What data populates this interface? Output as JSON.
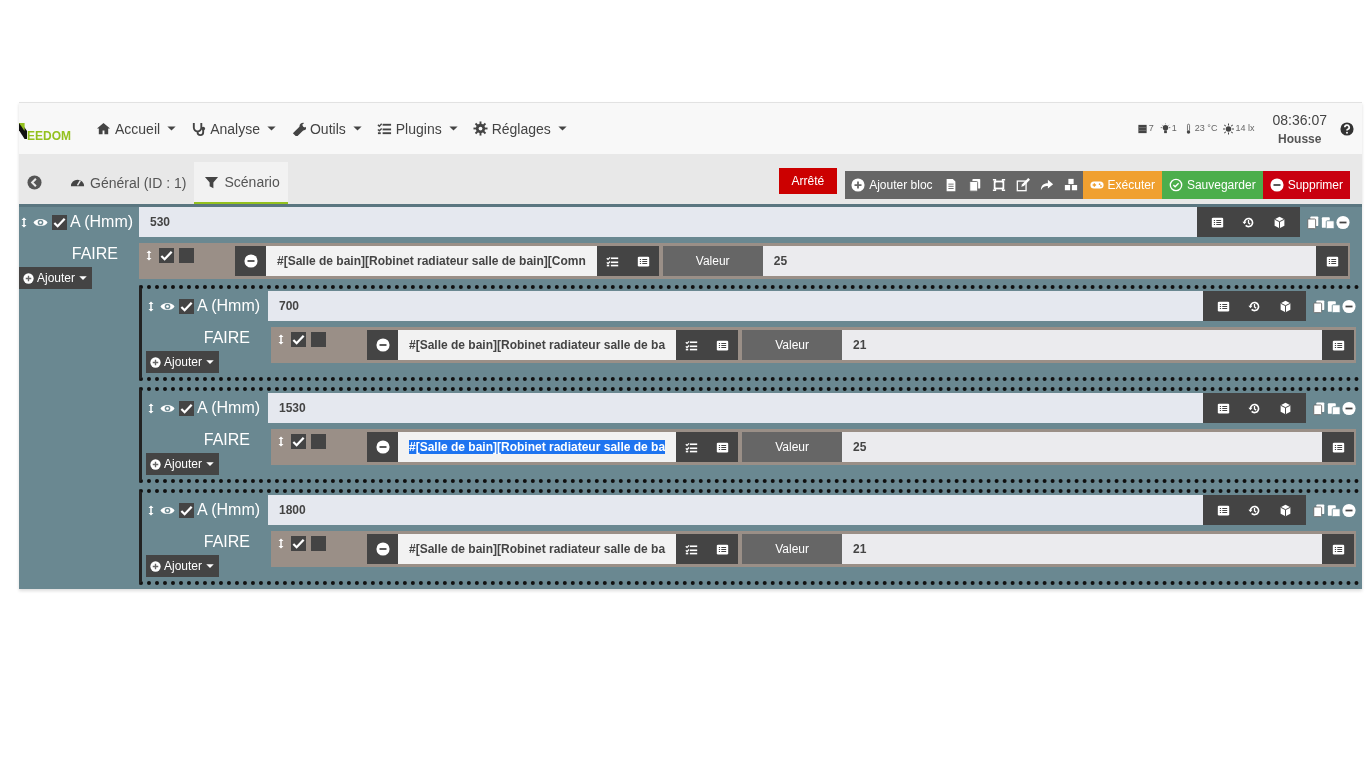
{
  "logo": {
    "text": "EEDOM"
  },
  "nav": [
    {
      "label": "Accueil"
    },
    {
      "label": "Analyse"
    },
    {
      "label": "Outils"
    },
    {
      "label": "Plugins"
    },
    {
      "label": "Réglages"
    }
  ],
  "status": {
    "widgets": [
      {
        "value": "7"
      },
      {
        "value": "1"
      },
      {
        "value": "23 °C"
      },
      {
        "value": "14 lx"
      }
    ],
    "time": "08:36:07",
    "user": "Housse"
  },
  "tabs": [
    {
      "label": "Général (ID : 1)",
      "selected": false
    },
    {
      "label": "Scénario",
      "selected": true
    }
  ],
  "state_badge": "Arrêté",
  "toolbar": {
    "add_block": "Ajouter bloc",
    "actions": [
      {
        "label": "Exécuter",
        "color": "#f0a030"
      },
      {
        "label": "Sauvegarder",
        "color": "#4cae4c"
      },
      {
        "label": "Supprimer",
        "color": "#c9000f"
      }
    ]
  },
  "block": {
    "label": "A (Hmm)",
    "visible": true,
    "enabled": true,
    "value": "530",
    "do_label": "FAIRE",
    "add_label": "Ajouter",
    "items": [
      {
        "kind": "action",
        "enabled": true,
        "background": false,
        "command": "#[Salle de bain][Robinet radiateur salle de bain][Comn",
        "command_selected": false,
        "option_label": "Valeur",
        "value": "25"
      },
      {
        "kind": "block",
        "label": "A (Hmm)",
        "visible": true,
        "enabled": true,
        "value": "700",
        "do_label": "FAIRE",
        "add_label": "Ajouter",
        "items": [
          {
            "kind": "action",
            "enabled": true,
            "background": false,
            "command": "#[Salle de bain][Robinet radiateur salle de ba",
            "command_selected": false,
            "option_label": "Valeur",
            "value": "21"
          }
        ]
      },
      {
        "kind": "block",
        "label": "A (Hmm)",
        "visible": true,
        "enabled": true,
        "value": "1530",
        "do_label": "FAIRE",
        "add_label": "Ajouter",
        "items": [
          {
            "kind": "action",
            "enabled": true,
            "background": false,
            "command": "#[Salle de bain][Robinet radiateur salle de ba",
            "command_selected": true,
            "option_label": "Valeur",
            "value": "25"
          }
        ]
      },
      {
        "kind": "block",
        "label": "A (Hmm)",
        "visible": true,
        "enabled": true,
        "value": "1800",
        "do_label": "FAIRE",
        "add_label": "Ajouter",
        "items": [
          {
            "kind": "action",
            "enabled": true,
            "background": false,
            "command": "#[Salle de bain][Robinet radiateur salle de ba",
            "command_selected": false,
            "option_label": "Valeur",
            "value": "21"
          }
        ]
      }
    ]
  }
}
